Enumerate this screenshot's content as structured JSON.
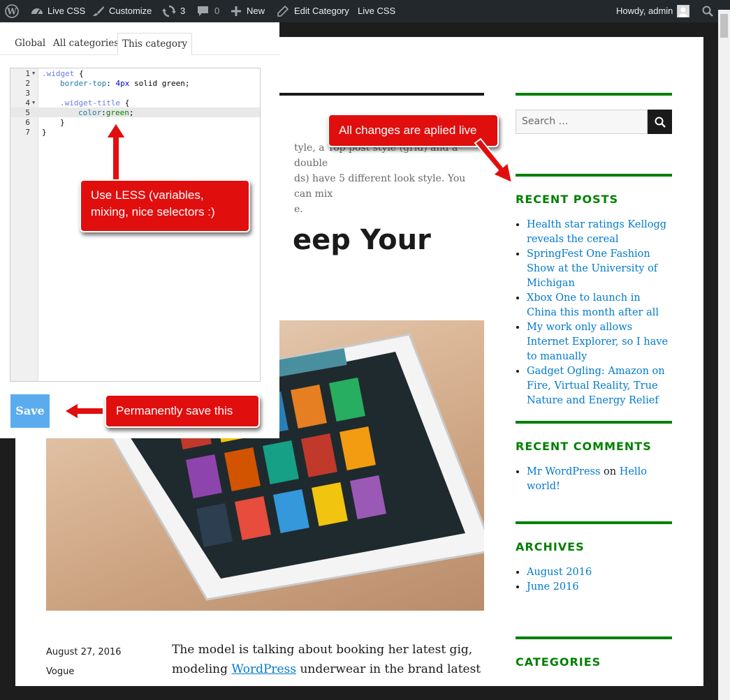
{
  "admin_bar": {
    "live_css_label": "Live CSS",
    "customize_label": "Customize",
    "updates_count": "3",
    "comments_count": "0",
    "new_label": "New",
    "edit_category_label": "Edit Category",
    "live_css_label_2": "Live CSS",
    "howdy_label": "Howdy, admin"
  },
  "panel": {
    "tabs": [
      {
        "label": "Global"
      },
      {
        "label": "All categories"
      },
      {
        "label": "This category"
      }
    ],
    "editor": {
      "line_numbers": [
        "1",
        "2",
        "3",
        "4",
        "5",
        "6",
        "7"
      ],
      "lines": [
        {
          "selector": ".widget",
          "brace": " {"
        },
        {
          "prop": "border-top",
          "sep": ": ",
          "num": "4px",
          "rest": " solid green;"
        },
        {
          "text": ""
        },
        {
          "selector": ".widget-title",
          "brace": " {"
        },
        {
          "prop": "color",
          "sep": ":",
          "val": "green",
          "end": ";"
        },
        {
          "text": "}"
        },
        {
          "text": "}"
        }
      ]
    },
    "save_label": "Save"
  },
  "callouts": {
    "less": "Use LESS (variables, mixing, nice selectors :)",
    "live": "All changes are aplied live",
    "save": "Permanently save this"
  },
  "main": {
    "excerpt_line1": "tyle, a Top post style (grid) and a double",
    "excerpt_line2": "ds) have 5 different look style. You can mix",
    "excerpt_line3": "e.",
    "post_title": "eep Your",
    "post_date": "August 27, 2016",
    "post_category": "Vogue",
    "body_line1": "The model is talking about booking her latest gig,",
    "body_line2_pre": "modeling ",
    "body_link": "WordPress",
    "body_line2_post": " underwear in the brand latest"
  },
  "sidebar": {
    "search_placeholder": "Search …",
    "recent_posts_title": "RECENT POSTS",
    "recent_posts": [
      "Health star ratings Kellogg reveals the cereal",
      "SpringFest One Fashion Show at the University of Michigan",
      "Xbox One to launch in China this month after all",
      "My work only allows Internet Explorer, so I have to manually",
      "Gadget Ogling: Amazon on Fire, Virtual Reality, True Nature and Energy Relief"
    ],
    "recent_comments_title": "RECENT COMMENTS",
    "comment_author": "Mr WordPress",
    "comment_on": "on",
    "comment_post": "Hello world!",
    "archives_title": "ARCHIVES",
    "archives": [
      "August 2016",
      "June 2016"
    ],
    "categories_title": "CATEGORIES"
  },
  "colors": {
    "admin_bar_bg": "#23282d",
    "widget_accent": "#008000",
    "link": "#007acc",
    "save_button": "#5aacee",
    "callout_red": "#e10e0e"
  }
}
